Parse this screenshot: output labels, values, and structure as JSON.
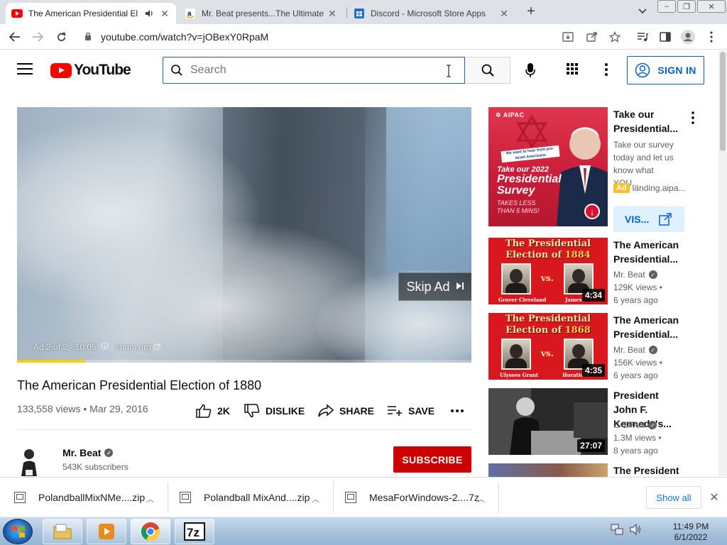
{
  "browser": {
    "tabs": [
      {
        "title": "The American Presidential El",
        "icon": "youtube-favicon"
      },
      {
        "title": "Mr. Beat presents...The Ultimate",
        "icon": "amazon-favicon"
      },
      {
        "title": "Discord - Microsoft Store Apps",
        "icon": "microsoft-store-favicon"
      }
    ],
    "url": "youtube.com/watch?v=jOBexY0RpaM"
  },
  "youtube": {
    "logo_text": "YouTube",
    "search_placeholder": "Search",
    "signin_label": "SIGN IN"
  },
  "player": {
    "skip_label": "Skip Ad",
    "ad_counter": "Ad 2 of 2 · 10:05",
    "ad_domain": "cham.org",
    "ad_progress": 0.15
  },
  "video": {
    "title": "The American Presidential Election of 1880",
    "views_date": "133,558 views • Mar 29, 2016",
    "like_count": "2K",
    "dislike_label": "DISLIKE",
    "share_label": "SHARE",
    "save_label": "SAVE"
  },
  "channel": {
    "name": "Mr. Beat",
    "subscribers": "543K subscribers",
    "subscribe_label": "SUBSCRIBE"
  },
  "sidebar": {
    "ad": {
      "title": "Take our Presidential...",
      "description": "Take our survey today and let us know what YOU...",
      "badge": "Ad",
      "domain": "landing.aipa...",
      "visit_label": "VIS...",
      "thumb_logo": "✡ AIPAC",
      "thumb_banner": "We want to hear from pro-Israel Americans",
      "thumb_line1": "Take our 2022",
      "thumb_line2": "Presidential Survey",
      "thumb_line3": "TAKES LESS THAN 5 MINS!"
    },
    "videos": [
      {
        "title": "The American Presidential...",
        "channel": "Mr. Beat",
        "views": "129K views •",
        "age": "6 years ago",
        "duration": "4:34",
        "thumb_title": "The Presidential",
        "thumb_sub": "Election of",
        "thumb_year": "1884",
        "thumb_vs": "vs.",
        "left_name": "Grover Cleveland",
        "right_name": "James"
      },
      {
        "title": "The American Presidential...",
        "channel": "Mr. Beat",
        "views": "156K views •",
        "age": "6 years ago",
        "duration": "4:35",
        "thumb_title": "The Presidential",
        "thumb_sub": "Election of",
        "thumb_year": "1868",
        "thumb_vs": "vs.",
        "left_name": "Ulysses Grant",
        "right_name": "Horatio S."
      },
      {
        "title": "President John F. Kennedy's...",
        "channel": "C-SPAN",
        "views": "1.3M views •",
        "age": "8 years ago",
        "duration": "27:07"
      },
      {
        "title": "The President"
      }
    ]
  },
  "downloads": {
    "items": [
      "PolandballMixNMe....zip",
      "Polandball MixAnd....zip",
      "MesaForWindows-2....7z"
    ],
    "show_all": "Show all"
  },
  "taskbar": {
    "time": "11:49 PM",
    "date": "6/1/2022"
  },
  "colors": {
    "youtube_red": "#ff0000",
    "subscribe_red": "#cc0000",
    "link_blue": "#065fd4",
    "ad_yellow": "#ffcc00"
  }
}
